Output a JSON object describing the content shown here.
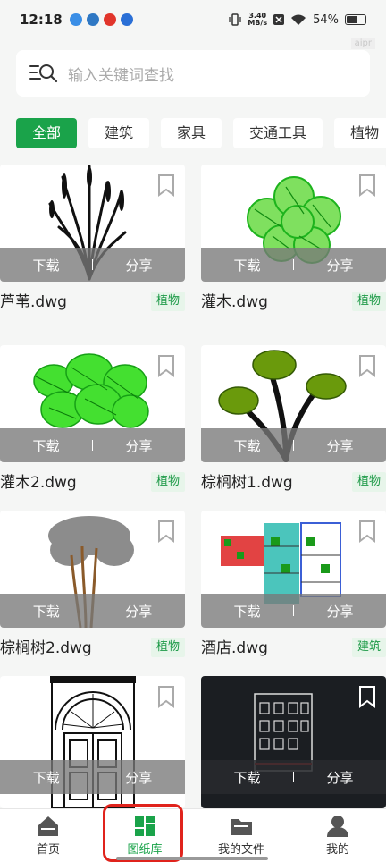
{
  "status": {
    "time": "12:18",
    "speed_value": "3.40",
    "speed_unit": "MB/s",
    "battery": "54%"
  },
  "watermark": "aipr",
  "search": {
    "placeholder": "输入关键词查找"
  },
  "categories": [
    {
      "label": "全部",
      "active": true
    },
    {
      "label": "建筑",
      "active": false
    },
    {
      "label": "家具",
      "active": false
    },
    {
      "label": "交通工具",
      "active": false
    },
    {
      "label": "植物",
      "active": false
    }
  ],
  "card_actions": {
    "download": "下载",
    "share": "分享"
  },
  "items": [
    {
      "name": "芦苇.dwg",
      "tag": "植物",
      "art": "reed-drawing"
    },
    {
      "name": "灌木.dwg",
      "tag": "植物",
      "art": "green-shrub-drawing"
    },
    {
      "name": "灌木2.dwg",
      "tag": "植物",
      "art": "bright-green-shrub-drawing"
    },
    {
      "name": "棕榈树1.dwg",
      "tag": "植物",
      "art": "palm-tree-drawing"
    },
    {
      "name": "棕榈树2.dwg",
      "tag": "植物",
      "art": "grey-palm-tree-drawing"
    },
    {
      "name": "酒店.dwg",
      "tag": "建筑",
      "art": "hotel-plan-drawing"
    },
    {
      "name": "",
      "tag": "",
      "art": "door-elevation-drawing"
    },
    {
      "name": "",
      "tag": "",
      "art": "building-facade-drawing"
    }
  ],
  "nav": [
    {
      "label": "首页",
      "icon": "home-icon",
      "active": false
    },
    {
      "label": "图纸库",
      "icon": "library-icon",
      "active": true
    },
    {
      "label": "我的文件",
      "icon": "folder-icon",
      "active": false
    },
    {
      "label": "我的",
      "icon": "user-icon",
      "active": false
    }
  ],
  "colors": {
    "accent": "#1aa34a",
    "tag_bg": "#e7f5ea",
    "highlight": "#e0231c"
  }
}
